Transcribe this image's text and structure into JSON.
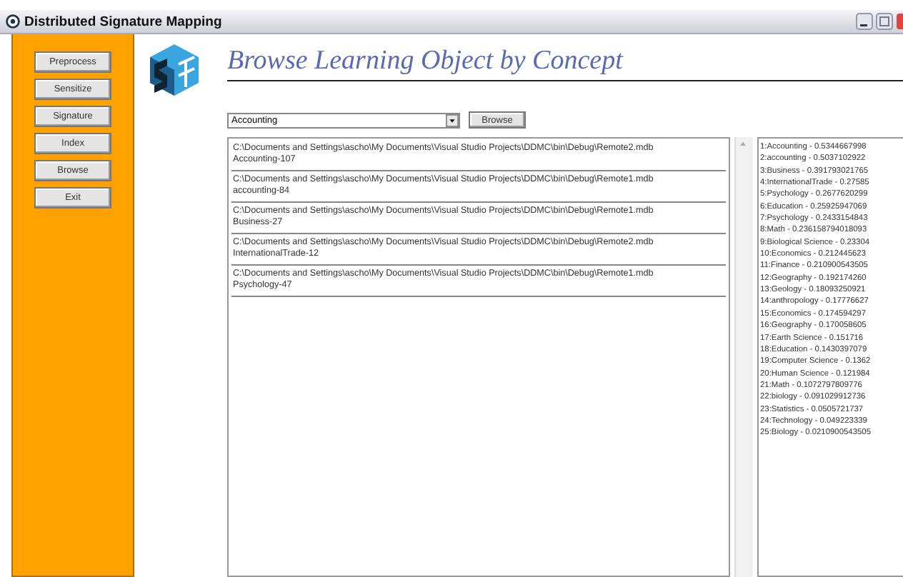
{
  "window": {
    "title": "Distributed Signature Mapping"
  },
  "nav_buttons": [
    "Preprocess",
    "Sensitize",
    "Signature",
    "Index",
    "Browse",
    "Exit"
  ],
  "heading": "Browse Learning Object by Concept",
  "concept_select": {
    "value": "Accounting"
  },
  "browse_button": "Browse",
  "results": [
    {
      "path": "C:\\Documents and Settings\\ascho\\My Documents\\Visual Studio Projects\\DDMC\\bin\\Debug\\Remote2.mdb",
      "name": "Accounting-107"
    },
    {
      "path": "C:\\Documents and Settings\\ascho\\My Documents\\Visual Studio Projects\\DDMC\\bin\\Debug\\Remote1.mdb",
      "name": "accounting-84"
    },
    {
      "path": "C:\\Documents and Settings\\ascho\\My Documents\\Visual Studio Projects\\DDMC\\bin\\Debug\\Remote1.mdb",
      "name": "Business-27"
    },
    {
      "path": "C:\\Documents and Settings\\ascho\\My Documents\\Visual Studio Projects\\DDMC\\bin\\Debug\\Remote2.mdb",
      "name": "InternationalTrade-12"
    },
    {
      "path": "C:\\Documents and Settings\\ascho\\My Documents\\Visual Studio Projects\\DDMC\\bin\\Debug\\Remote1.mdb",
      "name": "Psychology-47"
    }
  ],
  "ranking": [
    "1:Accounting - 0.5344667998",
    "2:accounting - 0.5037102922",
    "3:Business - 0.391793021765",
    "4:InternationalTrade - 0.27585",
    "5:Psychology - 0.2677620299",
    "6:Education - 0.25925947069",
    "7:Psychology - 0.2433154843",
    "8:Math - 0.236158794018093",
    "9:Biological Science - 0.23304",
    "10:Economics - 0.212445623",
    "11:Finance - 0.210900543505",
    "12:Geography - 0.192174260",
    "13:Geology - 0.18093250921",
    "14:anthropology - 0.17776627",
    "15:Economics - 0.174594297",
    "16:Geography - 0.170058605",
    "17:Earth Science - 0.151716",
    "18:Education - 0.1430397079",
    "19:Computer Science - 0.1362",
    "20:Human Science - 0.121984",
    "21:Math - 0.1072797809776",
    "22:biology - 0.091029912736",
    "23:Statistics - 0.0505721737",
    "24:Technology - 0.049223339",
    "25:Biology - 0.0210900543505"
  ]
}
